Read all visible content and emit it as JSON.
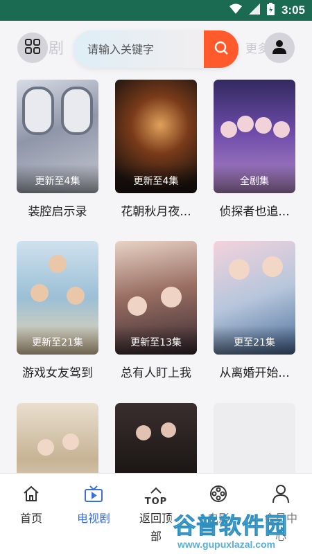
{
  "status_bar": {
    "time": "3:05"
  },
  "header": {
    "bg_title": "剧",
    "bg_more": "更多",
    "search_placeholder": "请输入关键字"
  },
  "grid": [
    {
      "title": "装腔启示录",
      "episodes": "更新至4集"
    },
    {
      "title": "花朝秋月夜...",
      "episodes": "更新至4集"
    },
    {
      "title": "侦探者也追...",
      "episodes": "全剧集"
    },
    {
      "title": "游戏女友驾到",
      "episodes": "更新至21集"
    },
    {
      "title": "总有人盯上我",
      "episodes": "更新至13集"
    },
    {
      "title": "从离婚开始...",
      "episodes": "更至21集"
    },
    {
      "title": "",
      "episodes": ""
    },
    {
      "title": "",
      "episodes": ""
    },
    {
      "title": "",
      "episodes": ""
    }
  ],
  "tabbar": {
    "home": "首页",
    "tv": "电视剧",
    "top_icon_text": "TOP",
    "back_to_top": "返回顶部",
    "movie": "电影",
    "member": "会员中心"
  },
  "watermark": {
    "cn": "谷普软件园",
    "url": "www.gupuxlazal.com"
  },
  "colors": {
    "accent": "#3b6fe0",
    "search_button": "#ff5a2c",
    "status_bar": "#1a6b52"
  },
  "icons": [
    "wifi-icon",
    "signal-icon",
    "battery-icon",
    "grid-menu-icon",
    "search-icon",
    "user-icon",
    "home-icon",
    "tv-icon",
    "top-arrow-icon",
    "film-reel-icon",
    "person-icon"
  ]
}
